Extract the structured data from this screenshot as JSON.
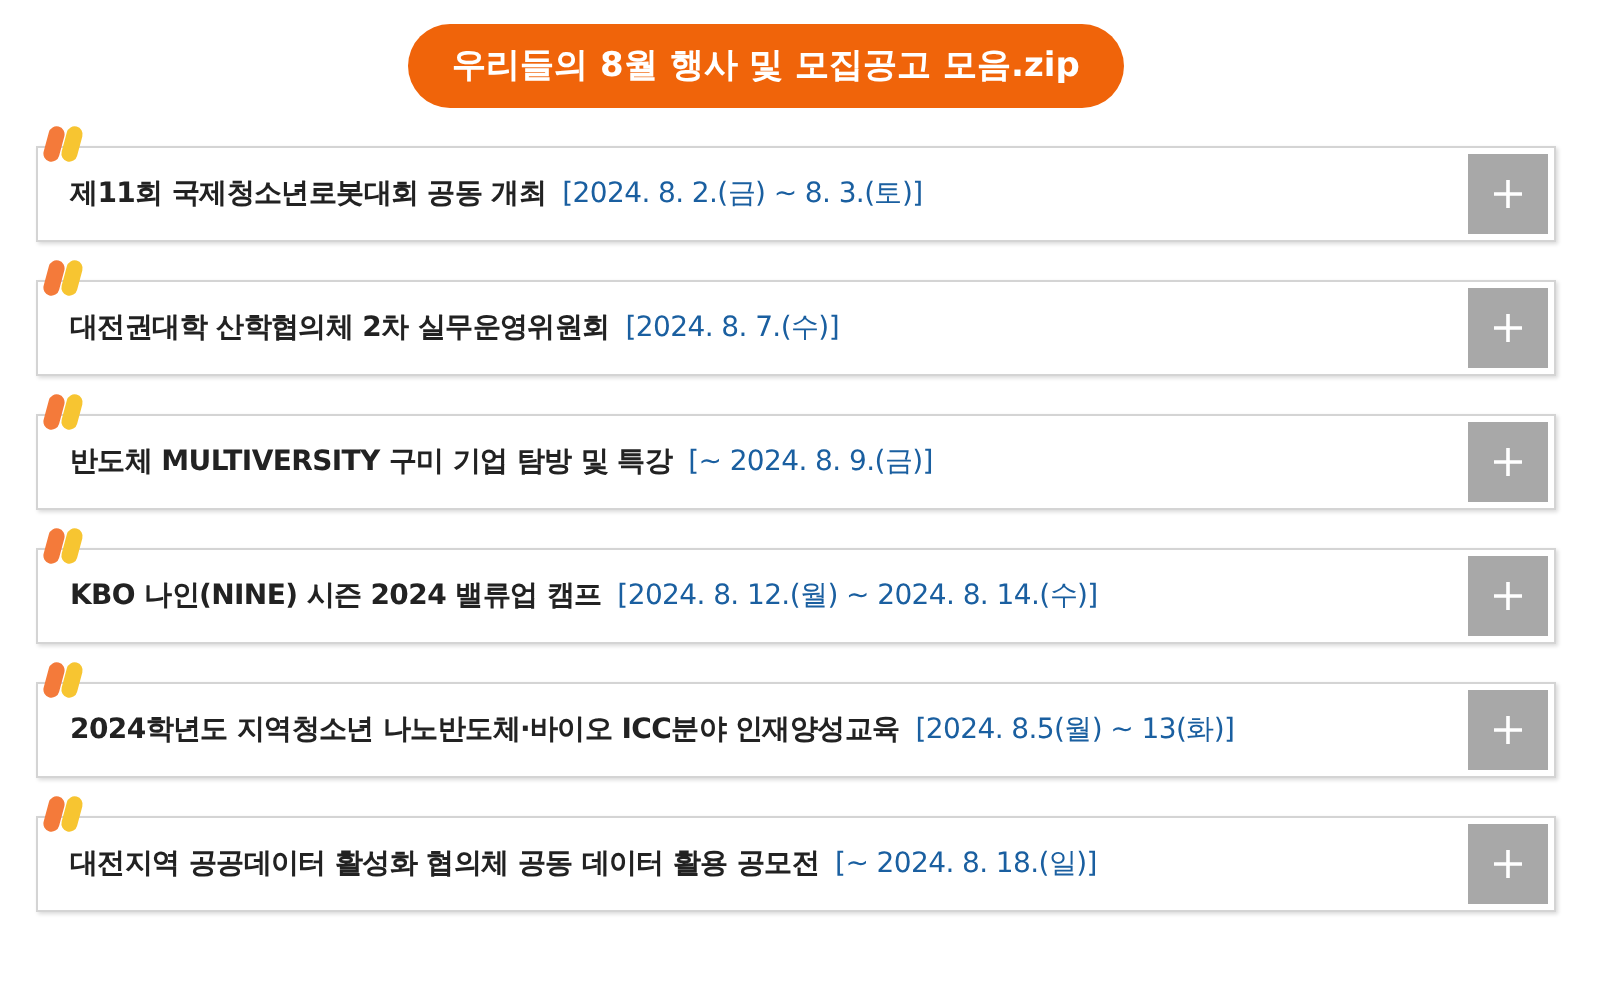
{
  "header": {
    "title": "우리들의 8월 행사 및 모집공고 모음.zip"
  },
  "events": [
    {
      "title": "제11회 국제청소년로봇대회 공동 개최",
      "date": "[2024. 8. 2.(금) ~ 8. 3.(토)]"
    },
    {
      "title": "대전권대학 산학협의체 2차 실무운영위원회",
      "date": "[2024. 8. 7.(수)]"
    },
    {
      "title": "반도체 MULTIVERSITY 구미 기업 탐방 및 특강",
      "date": "[~ 2024. 8. 9.(금)]"
    },
    {
      "title": "KBO 나인(NINE) 시즌 2024 밸류업 캠프",
      "date": "[2024. 8. 12.(월) ~ 2024. 8. 14.(수)]"
    },
    {
      "title": "2024학년도 지역청소년 나노반도체·바이오 ICC분야 인재양성교육",
      "date": "[2024. 8.5(월) ~ 13(화)]"
    },
    {
      "title": "대전지역 공공데이터 활성화 협의체 공동 데이터 활용 공모전",
      "date": "[~ 2024. 8. 18.(일)]"
    }
  ]
}
